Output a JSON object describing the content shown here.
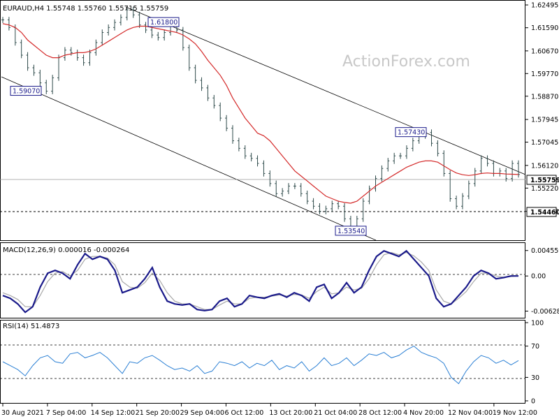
{
  "chart_data": [
    {
      "type": "line",
      "pane": "price",
      "instrument_label": "EURAUD,H4  1.55748 1.55760 1.55715 1.55759",
      "watermark": "ActionForex.com",
      "ylim": [
        1.5326,
        1.6258
      ],
      "y_ticks": [
        "1.62495",
        "1.61590",
        "1.60670",
        "1.59770",
        "1.58870",
        "1.57945",
        "1.57045",
        "1.56120",
        "1.55220",
        "1.54295"
      ],
      "x_ticks": [
        "30 Aug 2021",
        "7 Sep 04:00",
        "14 Sep 12:00",
        "21 Sep 20:00",
        "29 Sep 04:00",
        "6 Oct 12:00",
        "13 Oct 20:00",
        "21 Oct 04:00",
        "28 Oct 12:00",
        "4 Nov 20:00",
        "12 Nov 04:00",
        "19 Nov 12:00"
      ],
      "current_price": "1.55759",
      "support_level": "1.54460",
      "annotations": [
        {
          "text": "1.59070",
          "price": 1.5907
        },
        {
          "text": "1.61800",
          "price": 1.618
        },
        {
          "text": "1.57430",
          "price": 1.5743
        },
        {
          "text": "1.53540",
          "price": 1.5354
        }
      ],
      "series": [
        {
          "values": [
            1.619,
            1.616,
            1.61,
            1.605,
            1.6,
            1.598,
            1.594,
            1.5907,
            1.596,
            1.604,
            1.607,
            1.606,
            1.604,
            1.602,
            1.606,
            1.61,
            1.614,
            1.616,
            1.618,
            1.62,
            1.623,
            1.621,
            1.617,
            1.615,
            1.613,
            1.612,
            1.614,
            1.617,
            1.615,
            1.608,
            1.6,
            1.595,
            1.592,
            1.588,
            1.585,
            1.58,
            1.576,
            1.571,
            1.568,
            1.565,
            1.564,
            1.562,
            1.558,
            1.554,
            1.55,
            1.551,
            1.553,
            1.553,
            1.55,
            1.547,
            1.545,
            1.543,
            1.544,
            1.546,
            1.545,
            1.54,
            1.537,
            1.54,
            1.547,
            1.552,
            1.556,
            1.56,
            1.563,
            1.565,
            1.565,
            1.568,
            1.571,
            1.573,
            1.5743,
            1.57,
            1.566,
            1.558,
            1.548,
            1.545,
            1.549,
            1.554,
            1.559,
            1.564,
            1.562,
            1.558,
            1.559,
            1.556,
            1.562,
            1.5576
          ]
        },
        {
          "values": [
            1.6175,
            1.617,
            1.616,
            1.614,
            1.611,
            1.609,
            1.607,
            1.605,
            1.604,
            1.604,
            1.605,
            1.6055,
            1.606,
            1.606,
            1.6065,
            1.6075,
            1.609,
            1.6105,
            1.612,
            1.6135,
            1.615,
            1.616,
            1.6165,
            1.6165,
            1.616,
            1.6155,
            1.615,
            1.6145,
            1.614,
            1.613,
            1.6115,
            1.6095,
            1.6065,
            1.603,
            1.6,
            1.597,
            1.593,
            1.588,
            1.584,
            1.58,
            1.577,
            1.574,
            1.573,
            1.571,
            1.568,
            1.565,
            1.562,
            1.559,
            1.557,
            1.555,
            1.553,
            1.551,
            1.549,
            1.548,
            1.547,
            1.5465,
            1.5462,
            1.547,
            1.549,
            1.551,
            1.553,
            1.5545,
            1.556,
            1.5575,
            1.559,
            1.5605,
            1.5615,
            1.5625,
            1.563,
            1.563,
            1.5625,
            1.561,
            1.5595,
            1.5582,
            1.5575,
            1.5572,
            1.5575,
            1.558,
            1.5582,
            1.558,
            1.558,
            1.5578,
            1.5577,
            1.5576
          ]
        }
      ]
    },
    {
      "type": "line",
      "pane": "MACD",
      "label": "MACD(12,26,9) 0.000016 -0.000264",
      "y_ticks": [
        "0.004559",
        "0.00",
        "-0.006289"
      ],
      "ylim": [
        -0.0071,
        0.0054
      ],
      "series": [
        {
          "values": [
            -0.0035,
            -0.004,
            -0.005,
            -0.0065,
            -0.0055,
            -0.002,
            0.0005,
            0.001,
            0.0005,
            -0.0005,
            0.002,
            0.004,
            0.003,
            0.0035,
            0.003,
            0.001,
            -0.003,
            -0.0025,
            -0.002,
            -0.0005,
            0.0015,
            -0.002,
            -0.0045,
            -0.005,
            -0.0052,
            -0.005,
            -0.006,
            -0.0062,
            -0.006,
            -0.0045,
            -0.004,
            -0.0055,
            -0.005,
            -0.0035,
            -0.0038,
            -0.004,
            -0.0035,
            -0.0032,
            -0.0038,
            -0.003,
            -0.0035,
            -0.0045,
            -0.002,
            -0.0015,
            -0.004,
            -0.003,
            -0.0012,
            -0.003,
            -0.002,
            0.001,
            0.0035,
            0.0045,
            0.004,
            0.0035,
            0.0045,
            0.003,
            0.0015,
            0.0,
            -0.004,
            -0.0055,
            -0.005,
            -0.0035,
            -0.002,
            0.0,
            0.001,
            0.0005,
            -0.0005,
            -0.0003,
            0.0,
            0.0
          ]
        },
        {
          "values": [
            -0.003,
            -0.0035,
            -0.0042,
            -0.0055,
            -0.0055,
            -0.0035,
            -0.001,
            0.0005,
            0.0008,
            0.0,
            0.001,
            0.003,
            0.0035,
            0.0035,
            0.0032,
            0.002,
            -0.001,
            -0.002,
            -0.0022,
            -0.0012,
            0.0005,
            -0.0008,
            -0.003,
            -0.0045,
            -0.005,
            -0.005,
            -0.0055,
            -0.006,
            -0.006,
            -0.0052,
            -0.0045,
            -0.005,
            -0.005,
            -0.004,
            -0.0038,
            -0.0038,
            -0.0036,
            -0.0034,
            -0.0036,
            -0.0033,
            -0.0034,
            -0.004,
            -0.0028,
            -0.002,
            -0.0032,
            -0.003,
            -0.002,
            -0.0025,
            -0.0022,
            -0.0005,
            0.002,
            0.0038,
            0.0042,
            0.0038,
            0.0042,
            0.0036,
            0.0025,
            0.001,
            -0.0025,
            -0.0045,
            -0.005,
            -0.004,
            -0.0028,
            -0.001,
            0.0005,
            0.0005,
            0.0,
            -0.0002,
            -0.0001,
            0.0
          ]
        }
      ]
    },
    {
      "type": "line",
      "pane": "RSI",
      "label": "RSI(14) 51.4873",
      "y_ticks": [
        "100",
        "70",
        "30",
        "0"
      ],
      "ylim": [
        0,
        100
      ],
      "levels": [
        70,
        30
      ],
      "series": [
        {
          "values": [
            50,
            45,
            40,
            32,
            45,
            55,
            58,
            50,
            48,
            60,
            62,
            55,
            58,
            62,
            55,
            45,
            35,
            50,
            48,
            55,
            58,
            52,
            45,
            40,
            42,
            38,
            45,
            35,
            38,
            50,
            48,
            45,
            50,
            42,
            48,
            45,
            52,
            40,
            45,
            42,
            50,
            38,
            45,
            55,
            45,
            48,
            55,
            45,
            52,
            60,
            58,
            62,
            55,
            58,
            65,
            70,
            62,
            58,
            55,
            48,
            30,
            22,
            38,
            50,
            58,
            55,
            48,
            52,
            46,
            51.5
          ]
        }
      ]
    }
  ]
}
